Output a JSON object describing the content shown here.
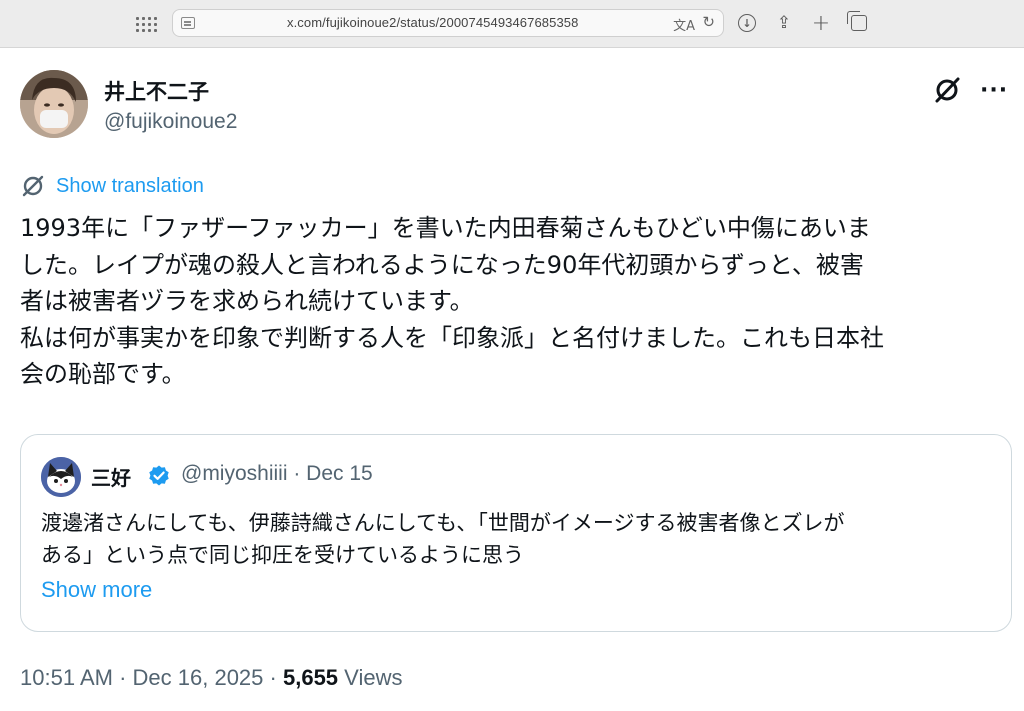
{
  "browser": {
    "url": "x.com/fujikoinoue2/status/2000745493467685358",
    "translate_glyph": "文A",
    "reload_glyph": "↻",
    "share_glyph": "⇪",
    "plus_glyph": "+"
  },
  "tweet": {
    "display_name": "井上不二子",
    "handle": "@fujikoinoue2",
    "more_glyph": "···",
    "show_translation": "Show translation",
    "body_lines": [
      "1993年に「ファザーファッカー」を書いた内田春菊さんもひどい中傷にあいま",
      "した。レイプが魂の殺人と言われるようになった90年代初頭からずっと、被害",
      "者は被害者ヅラを求められ続けています。",
      "私は何が事実かを印象で判断する人を「印象派」と名付けました。これも日本社",
      "会の恥部です。"
    ],
    "time": "10:51 AM",
    "separator": "·",
    "date": "Dec 16, 2025",
    "views_count": "5,655",
    "views_label": "Views"
  },
  "quote": {
    "display_name": "三好",
    "handle_date": "@miyoshiiii · Dec 15",
    "body_lines": [
      "渡邊渚さんにしても、伊藤詩織さんにしても、「世間がイメージする被害者像とズレが",
      "ある」という点で同じ抑圧を受けているように思う"
    ],
    "show_more": "Show more"
  },
  "colors": {
    "accent": "#1d9bf0",
    "text": "#0f1419",
    "muted": "#536471",
    "border": "#cfd9de"
  },
  "icons": [
    "grid-icon",
    "site-icon",
    "translate-icon",
    "reload-icon",
    "download-icon",
    "share-icon",
    "new-tab-icon",
    "tabs-icon",
    "grok-icon",
    "more-icon",
    "verified-icon"
  ]
}
